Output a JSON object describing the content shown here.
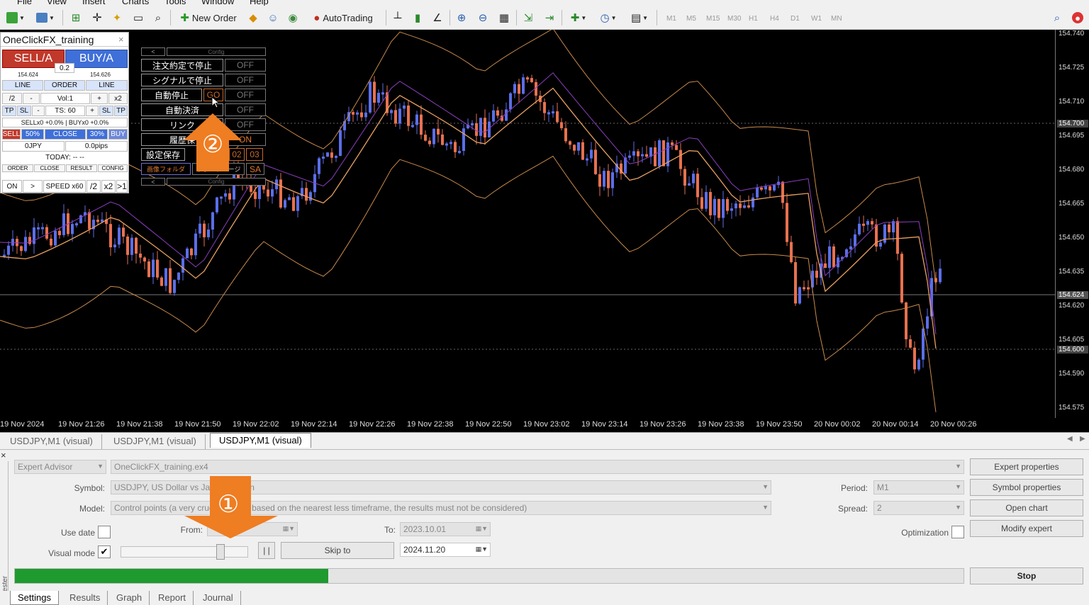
{
  "menu": {
    "items": [
      "File",
      "View",
      "Insert",
      "Charts",
      "Tools",
      "Window",
      "Help"
    ]
  },
  "toolbar": {
    "new_order": "New Order",
    "autotrading": "AutoTrading",
    "timeframes": [
      "M1",
      "M5",
      "M15",
      "M30",
      "H1",
      "H4",
      "D1",
      "W1",
      "MN"
    ]
  },
  "price_axis": {
    "labels": [
      "154.740",
      "154.725",
      "154.710",
      "154.695",
      "154.680",
      "154.665",
      "154.650",
      "154.635",
      "154.620",
      "154.605",
      "154.590",
      "154.575"
    ],
    "bid_box": "154.624",
    "level_box_1": "154.700",
    "level_box_2": "154.600"
  },
  "time_axis": {
    "labels": [
      "19 Nov 2024",
      "19 Nov 21:26",
      "19 Nov 21:38",
      "19 Nov 21:50",
      "19 Nov 22:02",
      "19 Nov 22:14",
      "19 Nov 22:26",
      "19 Nov 22:38",
      "19 Nov 22:50",
      "19 Nov 23:02",
      "19 Nov 23:14",
      "19 Nov 23:26",
      "19 Nov 23:38",
      "19 Nov 23:50",
      "20 Nov 00:02",
      "20 Nov 00:14",
      "20 Nov 00:26"
    ]
  },
  "chart_tabs": [
    "USDJPY,M1 (visual)",
    "USDJPY,M1 (visual)",
    "USDJPY,M1 (visual)"
  ],
  "panel": {
    "title": "OneClickFX_training",
    "sell": "SELL/A",
    "buy": "BUY/A",
    "spread": "0.2",
    "sell_price": "154.624",
    "buy_price": "154.626",
    "line_left": "LINE",
    "order": "ORDER",
    "line_right": "LINE",
    "half": "/2",
    "minus": "-",
    "vol": "Vol:1",
    "plus": "+",
    "double": "x2",
    "tp_left": "TP",
    "sl_left": "SL",
    "minus2": "-",
    "ts": "TS: 60",
    "plus2": "+",
    "sl_right": "SL",
    "tp_right": "TP",
    "positions": "SELLx0 +0.0% | BUYx0 +0.0%",
    "sell_small": "SELL",
    "pct50": "50%",
    "close": "CLOSE",
    "pct30": "30%",
    "buy_small": "BUY",
    "jpy": "0JPY",
    "pips": "0.0pips",
    "today": "TODAY: -- --",
    "tab_order": "ORDER",
    "tab_close": "CLOSE",
    "tab_result": "RESULT",
    "tab_config": "CONFIG",
    "on": "ON",
    "next": ">",
    "speed": "SPEED x60",
    "slow": "/2",
    "fast": "x2",
    "skip": ">1"
  },
  "config": {
    "header_left": "<",
    "header_right": "Config",
    "rows": [
      {
        "label": "注文約定で停止",
        "value": "OFF"
      },
      {
        "label": "シグナルで停止",
        "value": "OFF"
      },
      {
        "label": "自動停止",
        "value": "OFF"
      },
      {
        "label": "自動決済",
        "value": "OFF"
      },
      {
        "label": "リンク",
        "value": "OFF"
      },
      {
        "label": "履歴保",
        "value": "ON"
      }
    ],
    "go": "GO",
    "save": "設定保存",
    "n02": "02",
    "n03": "03",
    "folder": "画像フォルダ",
    "support": "サポートページ",
    "sa": "SA",
    "footer_left": "<",
    "footer_right": "Config"
  },
  "badges": {
    "one": "①",
    "two": "②"
  },
  "tester": {
    "type": "Expert Advisor",
    "expert": "OneClickFX_training.ex4",
    "symbol_label": "Symbol:",
    "symbol": "USDJPY, US Dollar vs Japanese Yen",
    "model_label": "Model:",
    "model": "Control points (a very crude method based on the nearest less timeframe, the results must not be considered)",
    "usedate_label": "Use date",
    "from_label": "From:",
    "from": "",
    "to_label": "To:",
    "to": "2023.10.01",
    "visual_label": "Visual mode",
    "visual_checked": "✔",
    "pause": "| |",
    "skip_to": "Skip to",
    "skip_date": "2024.11.20",
    "period_label": "Period:",
    "period": "M1",
    "spread_label": "Spread:",
    "spread": "2",
    "optimization_label": "Optimization",
    "expert_props": "Expert properties",
    "symbol_props": "Symbol properties",
    "open_chart": "Open chart",
    "modify_expert": "Modify expert",
    "progress": 0.33,
    "stop": "Stop"
  },
  "bottom_tabs": [
    "Settings",
    "Results",
    "Graph",
    "Report",
    "Journal"
  ],
  "side_label": "Tester",
  "colors": {
    "bull": "#5b6ee8",
    "bear": "#e8714f",
    "ma": "#e8a060",
    "band": "#c98a4a",
    "ma_slow": "#8b3fc0",
    "progress": "#1f9a2f",
    "sell": "#c0392b",
    "buy": "#3f6fd8",
    "badge": "#ef7d22"
  }
}
